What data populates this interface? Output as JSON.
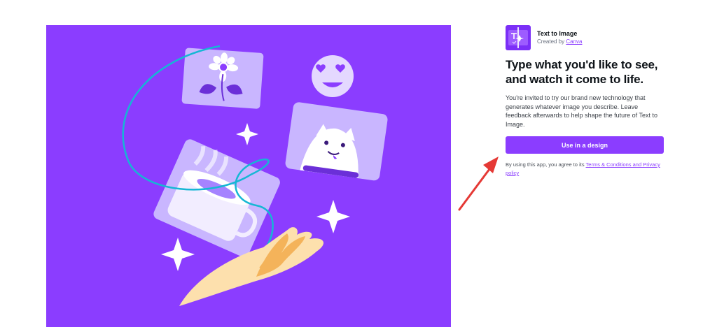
{
  "app": {
    "name": "Text to Image",
    "created_by_prefix": "Created by",
    "creator": "Canva",
    "icon": "text-to-image-app-icon"
  },
  "headline": "Type what you'd like to see, and watch it come to life.",
  "description": "You're invited to try our brand new technology that generates whatever image you describe. Leave feedback afterwards to help shape the future of Text to Image.",
  "cta_label": "Use in a design",
  "legal": {
    "prefix": "By using this app, you agree to its",
    "link": "Terms & Conditions and Privacy policy"
  },
  "colors": {
    "brand": "#8b3dff",
    "arrow": "#e53935"
  }
}
